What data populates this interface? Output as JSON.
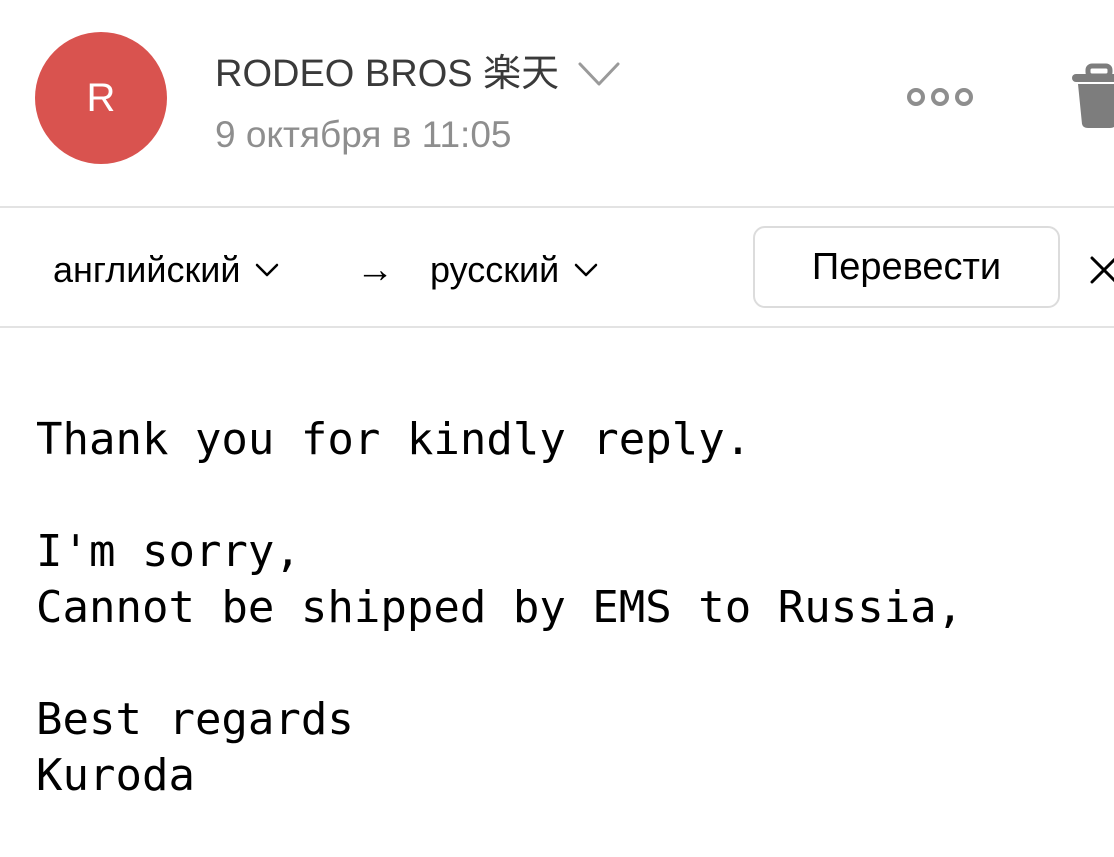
{
  "header": {
    "avatar_letter": "R",
    "avatar_color": "#d9534f",
    "sender_name": "RODEO BROS 楽天",
    "sent_date": "9 октября в 11:05",
    "icons": {
      "sender_expand": "chevron-down-icon",
      "more": "more-icon",
      "delete": "trash-icon"
    }
  },
  "translate_bar": {
    "source_language": "английский",
    "arrow": "→",
    "target_language": "русский",
    "translate_label": "Перевести",
    "close_icon": "close-icon"
  },
  "message": {
    "lines": [
      "Thank you for kindly reply.",
      "",
      "I'm sorry,",
      "Cannot be shipped by EMS to Russia,",
      "",
      "Best regards",
      "Kuroda"
    ]
  }
}
